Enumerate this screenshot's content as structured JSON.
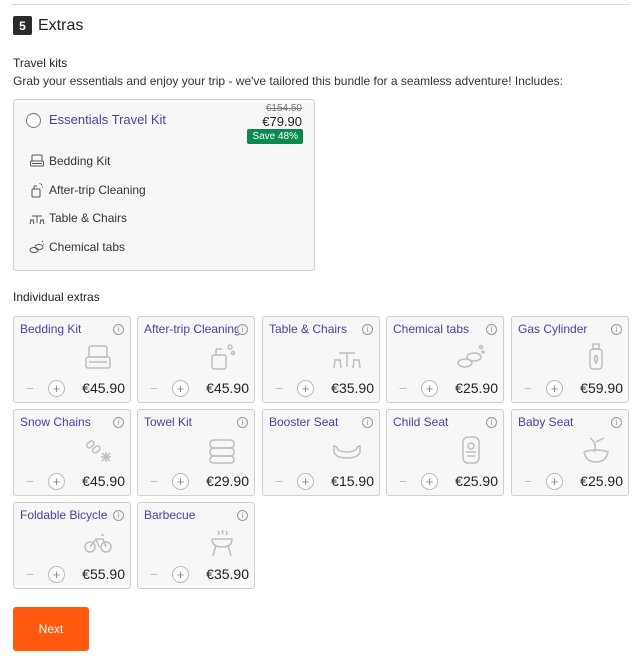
{
  "step": {
    "number": "5",
    "title": "Extras"
  },
  "travel_kits": {
    "heading": "Travel kits",
    "description": "Grab your essentials and enjoy your trip - we've tailored this bundle for a seamless adventure! Includes:",
    "kit": {
      "name": "Essentials Travel Kit",
      "original_price": "€154.50",
      "price": "€79.90",
      "save_label": "Save 48%",
      "includes": [
        {
          "label": "Bedding Kit",
          "icon": "bedding-icon"
        },
        {
          "label": "After-trip Cleaning",
          "icon": "cleaning-icon"
        },
        {
          "label": "Table & Chairs",
          "icon": "table-chairs-icon"
        },
        {
          "label": "Chemical tabs",
          "icon": "chemical-tabs-icon"
        }
      ]
    }
  },
  "individual_extras": {
    "heading": "Individual extras",
    "items": [
      {
        "name": "Bedding Kit",
        "price": "€45.90",
        "icon": "bedding-icon"
      },
      {
        "name": "After-trip Cleaning",
        "price": "€45.90",
        "icon": "cleaning-icon"
      },
      {
        "name": "Table & Chairs",
        "price": "€35.90",
        "icon": "table-chairs-icon"
      },
      {
        "name": "Chemical tabs",
        "price": "€25.90",
        "icon": "chemical-tabs-icon"
      },
      {
        "name": "Gas Cylinder",
        "price": "€59.90",
        "icon": "gas-cylinder-icon"
      },
      {
        "name": "Snow Chains",
        "price": "€45.90",
        "icon": "snow-chains-icon"
      },
      {
        "name": "Towel Kit",
        "price": "€29.90",
        "icon": "towel-icon"
      },
      {
        "name": "Booster Seat",
        "price": "€15.90",
        "icon": "booster-seat-icon"
      },
      {
        "name": "Child Seat",
        "price": "€25.90",
        "icon": "child-seat-icon"
      },
      {
        "name": "Baby Seat",
        "price": "€25.90",
        "icon": "baby-seat-icon"
      },
      {
        "name": "Foldable Bicycle",
        "price": "€55.90",
        "icon": "bicycle-icon"
      },
      {
        "name": "Barbecue",
        "price": "€35.90",
        "icon": "barbecue-icon"
      }
    ],
    "minus_label": "−",
    "plus_label": "+",
    "info_label": "i"
  },
  "next_button": {
    "label": "Next"
  },
  "colors": {
    "accent": "#ff5a0f",
    "link": "#4a3fa8",
    "save_badge": "#0b8a4f"
  }
}
